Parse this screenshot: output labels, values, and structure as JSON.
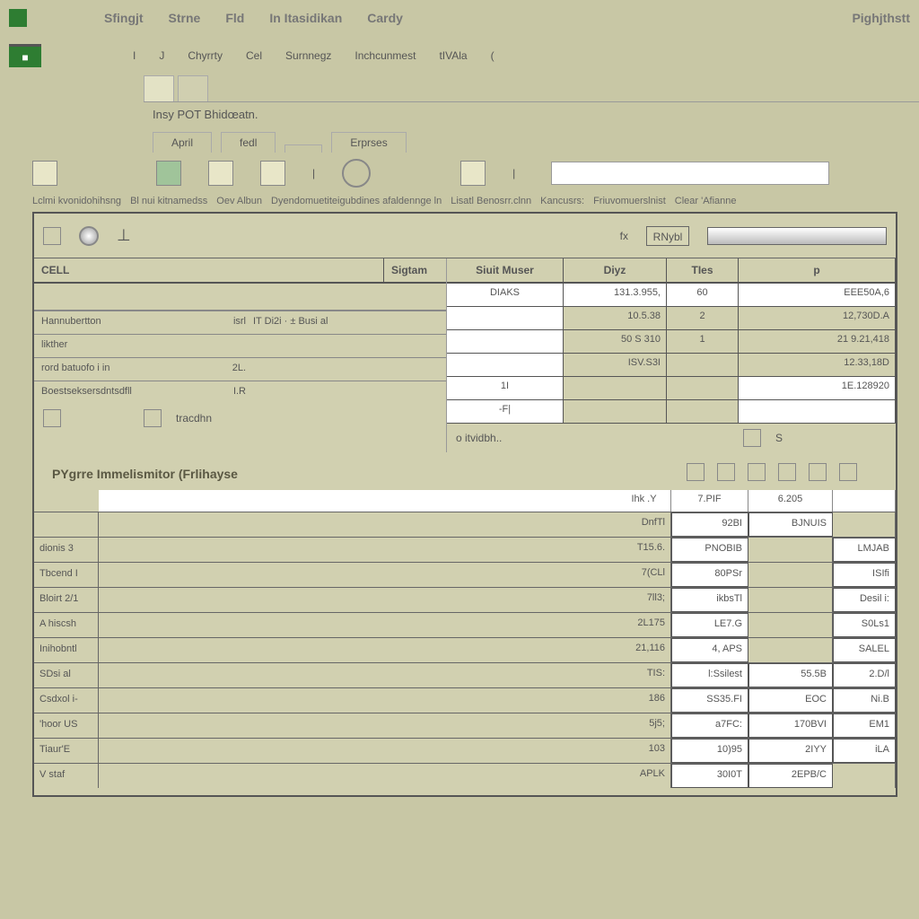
{
  "top_menu": {
    "items": [
      "Sfingjt",
      "Strne",
      "Fld",
      "In Itasidikan",
      "Cardy"
    ],
    "right": "Pighjthstt"
  },
  "sub_menu": {
    "items": [
      "I",
      "J",
      "Chyrrty",
      "Cel",
      "Surnnegz",
      "Inchcunmest",
      "tIVAla",
      "("
    ]
  },
  "filetab": {
    "tab1": "",
    "tab2": ""
  },
  "filename": "Insy POT Bhidœatn.",
  "sub_tabs": [
    "April",
    "fedl",
    "",
    "Erprses"
  ],
  "group_labels": [
    "Lclmi kvonidohihsng",
    "Bl nui kitnamedss",
    "Oev Albun",
    "Dyendomuetiteigubdines afaldennge ln",
    "Lisatl Benosrr.clnn",
    "Kancusrs:",
    "Friuvomuerslnist",
    "Clear 'Afianne"
  ],
  "panel_top": {
    "ruler": "RNybl"
  },
  "cell_section": {
    "header": "CELL",
    "header2": "Sigtam",
    "rows": [
      {
        "label": "",
        "val": "",
        "val2": ""
      },
      {
        "label": "Hannubertton",
        "val": "isrl",
        "val2": "IT Di2i · ± Busi  al"
      },
      {
        "label": "likther",
        "val": "",
        "val2": ""
      },
      {
        "label": "rord batuofo i in",
        "val": "2L.",
        "val2": ""
      },
      {
        "label": "Boestseksersdntsdfll",
        "val": "I.R",
        "val2": ""
      }
    ],
    "footer": "tracdhn"
  },
  "right_table": {
    "headers": [
      "Siuit Muser",
      "Diyz",
      "TIes",
      "p"
    ],
    "rows": [
      {
        "c1": "DIAKS",
        "c2": "131.3.955,",
        "c3": "60",
        "c4": "EEE50A,6"
      },
      {
        "c1": "",
        "c2": "10.5.38",
        "c3": "2",
        "c4": "12,730D.A"
      },
      {
        "c1": "",
        "c2": "50 S 310",
        "c3": "1",
        "c4": "21 9.21,418"
      },
      {
        "c1": "",
        "c2": "ISV.S3I",
        "c3": "",
        "c4": "12.33,18D"
      },
      {
        "c1": "1I",
        "c2": "",
        "c3": "",
        "c4": "1E.128920"
      },
      {
        "c1": "-F|",
        "c2": "",
        "c3": "",
        "c4": ""
      }
    ]
  },
  "below": {
    "left": "",
    "right_label": "o itvidbh..",
    "s_label": "S"
  },
  "lower": {
    "title": "PYgrre Immelismitor (Frlihayse",
    "col_headers": [
      "Ihk .Y",
      "7.PIF",
      "6.205",
      ""
    ],
    "rows": [
      {
        "label": "",
        "a": "DnfTl",
        "b": "92BI",
        "c": "BJNUIS",
        "d": ""
      },
      {
        "label": "dionis 3",
        "a": "T15.6.",
        "b": "PNOBIB",
        "c": "",
        "d": "LMJAB"
      },
      {
        "label": "Tbcend I",
        "a": "7(CLl",
        "b": "80PSr",
        "c": "",
        "d": "ISIfi"
      },
      {
        "label": "Bloirt 2/1",
        "a": "7ll3;",
        "b": "ikbsTl",
        "c": "",
        "d": "Desil i:"
      },
      {
        "label": "A hiscsh",
        "a": "2L175",
        "b": "LE7.G",
        "c": "",
        "d": "S0Ls1"
      },
      {
        "label": "Inihobntl",
        "a": "21,116",
        "b": "4, APS",
        "c": "",
        "d": "SALEL"
      },
      {
        "label": "SDsi al",
        "a": "TIS:",
        "b": "l:Ssilest",
        "c": "55.5B",
        "d": "2.D/l"
      },
      {
        "label": "Csdxol i-",
        "a": "186",
        "b": "SS35.FI",
        "c": "EOC",
        "d": "Ni.B"
      },
      {
        "label": "'hoor US",
        "a": "5j5;",
        "b": "a7FC:",
        "c": "170BVI",
        "d": "EM1"
      },
      {
        "label": "Tiaur'E",
        "a": "103",
        "b": "10)95",
        "c": "2IYY",
        "d": "iLA"
      },
      {
        "label": "V staf",
        "a": "APLK",
        "b": "30I0T",
        "c": "2EPB/C",
        "d": ""
      }
    ]
  }
}
